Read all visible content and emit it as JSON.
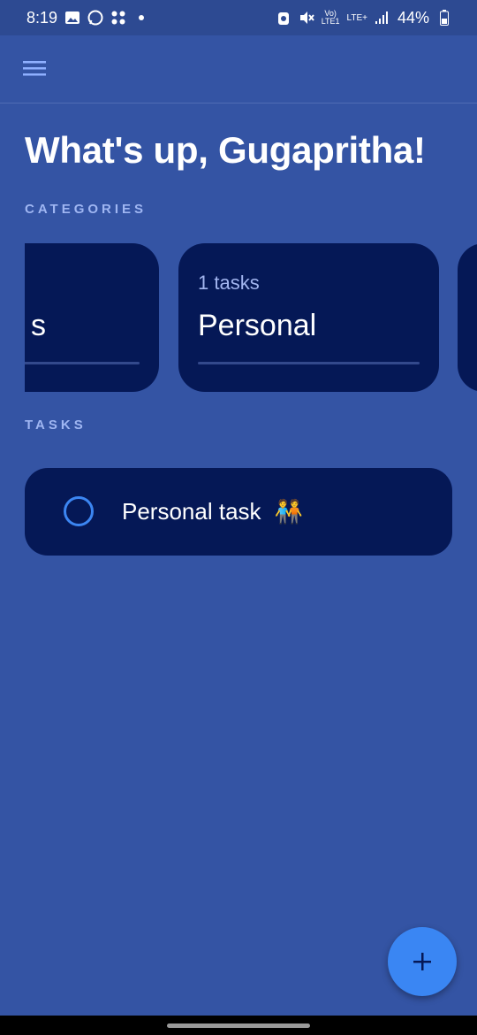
{
  "status_bar": {
    "time": "8:19",
    "network": "LTE+",
    "battery": "44%",
    "icons": [
      "gallery-icon",
      "whatsapp-icon",
      "app-notification-icon",
      "dot-icon",
      "data-saver-icon",
      "mute-icon",
      "volte-icon",
      "signal-icon",
      "battery-icon"
    ]
  },
  "app_bar": {
    "menu_icon": "hamburger-menu-icon"
  },
  "greeting": "What's up, Gugapritha!",
  "categories": {
    "label": "CATEGORIES",
    "items": [
      {
        "count": "",
        "name": "s"
      },
      {
        "count": "1 tasks",
        "name": "Personal"
      },
      {
        "count": "",
        "name": ""
      }
    ]
  },
  "tasks": {
    "label": "TASKS",
    "items": [
      {
        "title": "Personal task",
        "emoji": "🧑‍🤝‍🧑",
        "done": false
      }
    ]
  },
  "fab": {
    "icon": "plus-icon"
  },
  "colors": {
    "background": "#3454a4",
    "card": "#051856",
    "accent": "#3a86f3",
    "label": "#9fb6f2"
  }
}
